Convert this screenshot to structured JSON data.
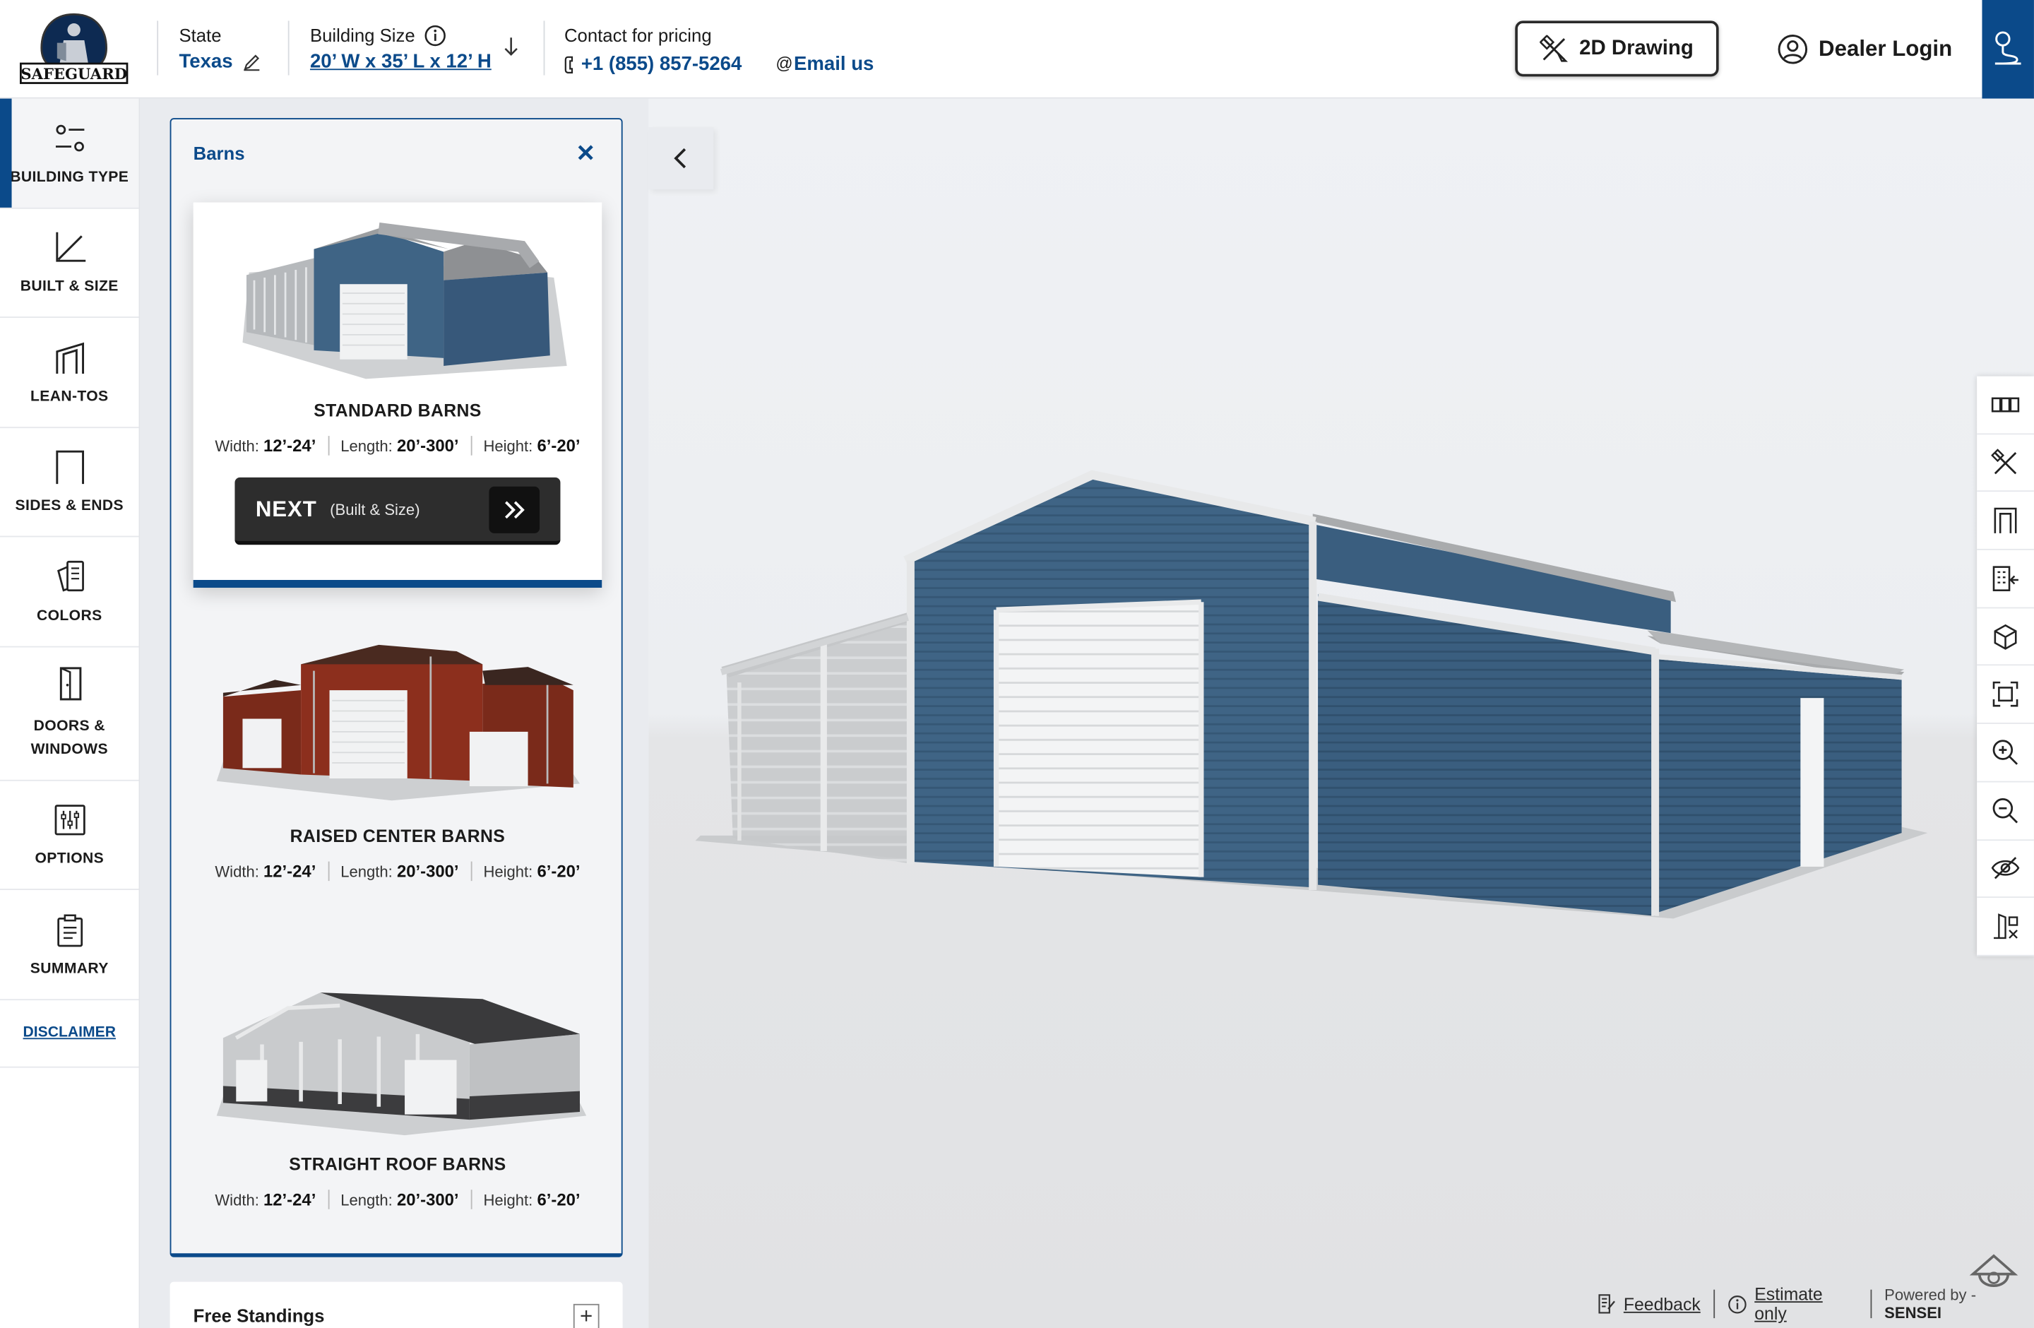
{
  "header": {
    "logo_text": "SAFEGUARD",
    "state_label": "State",
    "state_value": "Texas",
    "size_label": "Building Size",
    "size_value": "20’ W x 35’ L x 12’ H",
    "pricing_label": "Contact for pricing",
    "phone": "+1 (855) 857-5264",
    "email": "Email us",
    "drawing_button": "2D Drawing",
    "dealer_login": "Dealer Login"
  },
  "nav": {
    "items": [
      {
        "label": "BUILDING TYPE",
        "icon": "sliders-icon"
      },
      {
        "label": "BUILT & SIZE",
        "icon": "axis-icon"
      },
      {
        "label": "LEAN-TOS",
        "icon": "lean-to-icon"
      },
      {
        "label": "SIDES & ENDS",
        "icon": "frame-icon"
      },
      {
        "label": "COLORS",
        "icon": "swatch-icon"
      },
      {
        "label": "DOORS & WINDOWS",
        "icon": "door-icon"
      },
      {
        "label": "OPTIONS",
        "icon": "options-icon"
      },
      {
        "label": "SUMMARY",
        "icon": "clipboard-icon"
      }
    ],
    "disclaimer": "DISCLAIMER"
  },
  "panel": {
    "title": "Barns",
    "cards": [
      {
        "name": "STANDARD BARNS",
        "width": "12’-24’",
        "length": "20’-300’",
        "height": "6’-20’"
      },
      {
        "name": "RAISED CENTER BARNS",
        "width": "12’-24’",
        "length": "20’-300’",
        "height": "6’-20’"
      },
      {
        "name": "STRAIGHT ROOF BARNS",
        "width": "12’-24’",
        "length": "20’-300’",
        "height": "6’-20’"
      }
    ],
    "spec_labels": {
      "width": "Width:",
      "length": "Length:",
      "height": "Height:"
    },
    "next_label": "NEXT",
    "next_sub": "(Built & Size)",
    "free_standings": "Free Standings"
  },
  "footer": {
    "feedback": "Feedback",
    "estimate": "Estimate only",
    "powered": "Powered by -",
    "brand": "SENSEI"
  },
  "colors": {
    "brand": "#0b4a8a",
    "steel_blue": "#3f6485"
  }
}
